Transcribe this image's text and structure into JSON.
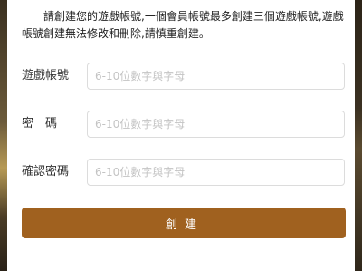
{
  "notice": "請創建您的遊戲帳號,一個會員帳號最多創建三個遊戲帳號,遊戲帳號創建無法修改和刪除,請慎重創建。",
  "form": {
    "fields": [
      {
        "label": "遊戲帳號",
        "placeholder": "6-10位數字與字母",
        "value": ""
      },
      {
        "label": "密　碼",
        "placeholder": "6-10位數字與字母",
        "value": ""
      },
      {
        "label": "確認密碼",
        "placeholder": "6-10位數字與字母",
        "value": ""
      }
    ],
    "submit_label": "創建"
  },
  "colors": {
    "accent": "#a0611f",
    "input_border": "#dcdcdc",
    "placeholder": "#c4c4c4"
  }
}
